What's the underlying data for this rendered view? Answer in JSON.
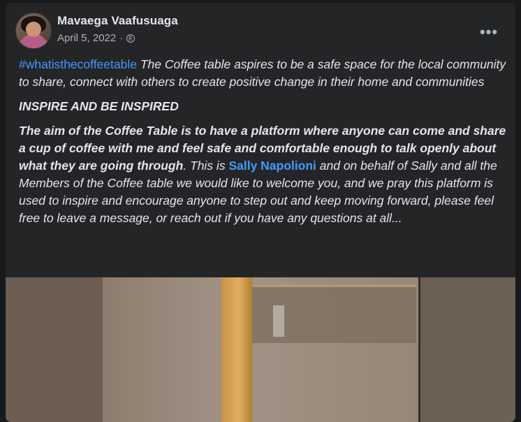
{
  "post": {
    "author": "Mavaega Vaafusuaga",
    "date": "April 5, 2022",
    "audience_icon": "globe-icon",
    "more_icon_label": "•••",
    "hashtag": "#whatisthecoffeetable",
    "intro": " The Coffee table aspires to be a safe space for the local community to share, connect with others to create positive change in their home and communities",
    "heading": "INSPIRE AND BE INSPIRED",
    "aim_bold": "The aim of the Coffee Table is to have a platform where anyone can come and share a cup of coffee with me and feel safe and comfortable enough to talk openly about what they are going through",
    "aim_rest_1": ". This is ",
    "mention": "Sally Napolioni",
    "aim_rest_2": " and on behalf of Sally and all the Members of the Coffee table we would like to welcome you, and we pray this platform is used to inspire and encourage anyone to step out and keep moving forward, please feel free to leave a message, or reach out if you have any questions at all..."
  },
  "colors": {
    "card_bg": "#242526",
    "text": "#e4e6eb",
    "secondary": "#b0b3b8",
    "link": "#4599ff"
  }
}
